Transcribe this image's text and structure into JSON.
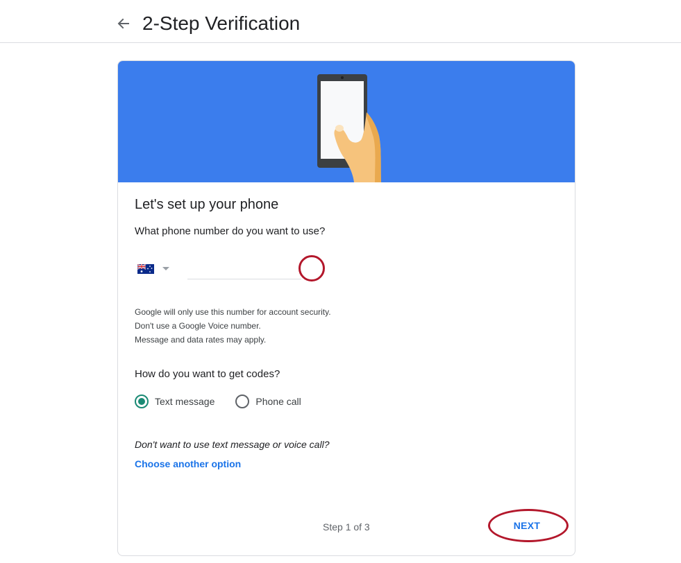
{
  "header": {
    "title": "2-Step Verification",
    "back_icon": "arrow-left-icon"
  },
  "colors": {
    "banner": "#3b7ded",
    "accent": "#1a73e8",
    "radio_selected": "#1a8a74",
    "highlight": "#b3172b"
  },
  "card": {
    "heading": "Let's set up your phone",
    "phone_question": "What phone number do you want to use?",
    "country": {
      "flag_icon": "australia-flag-icon",
      "dropdown_icon": "triangle-down-icon"
    },
    "phone_input": {
      "value": "",
      "placeholder": ""
    },
    "notes": [
      "Google will only use this number for account security.",
      "Don't use a Google Voice number.",
      "Message and data rates may apply."
    ],
    "codes_question": "How do you want to get codes?",
    "options": [
      {
        "label": "Text message",
        "selected": true
      },
      {
        "label": "Phone call",
        "selected": false
      }
    ],
    "alternative_question": "Don't want to use text message or voice call?",
    "alternative_link": "Choose another option",
    "step": "Step 1 of 3",
    "next_label": "NEXT"
  }
}
